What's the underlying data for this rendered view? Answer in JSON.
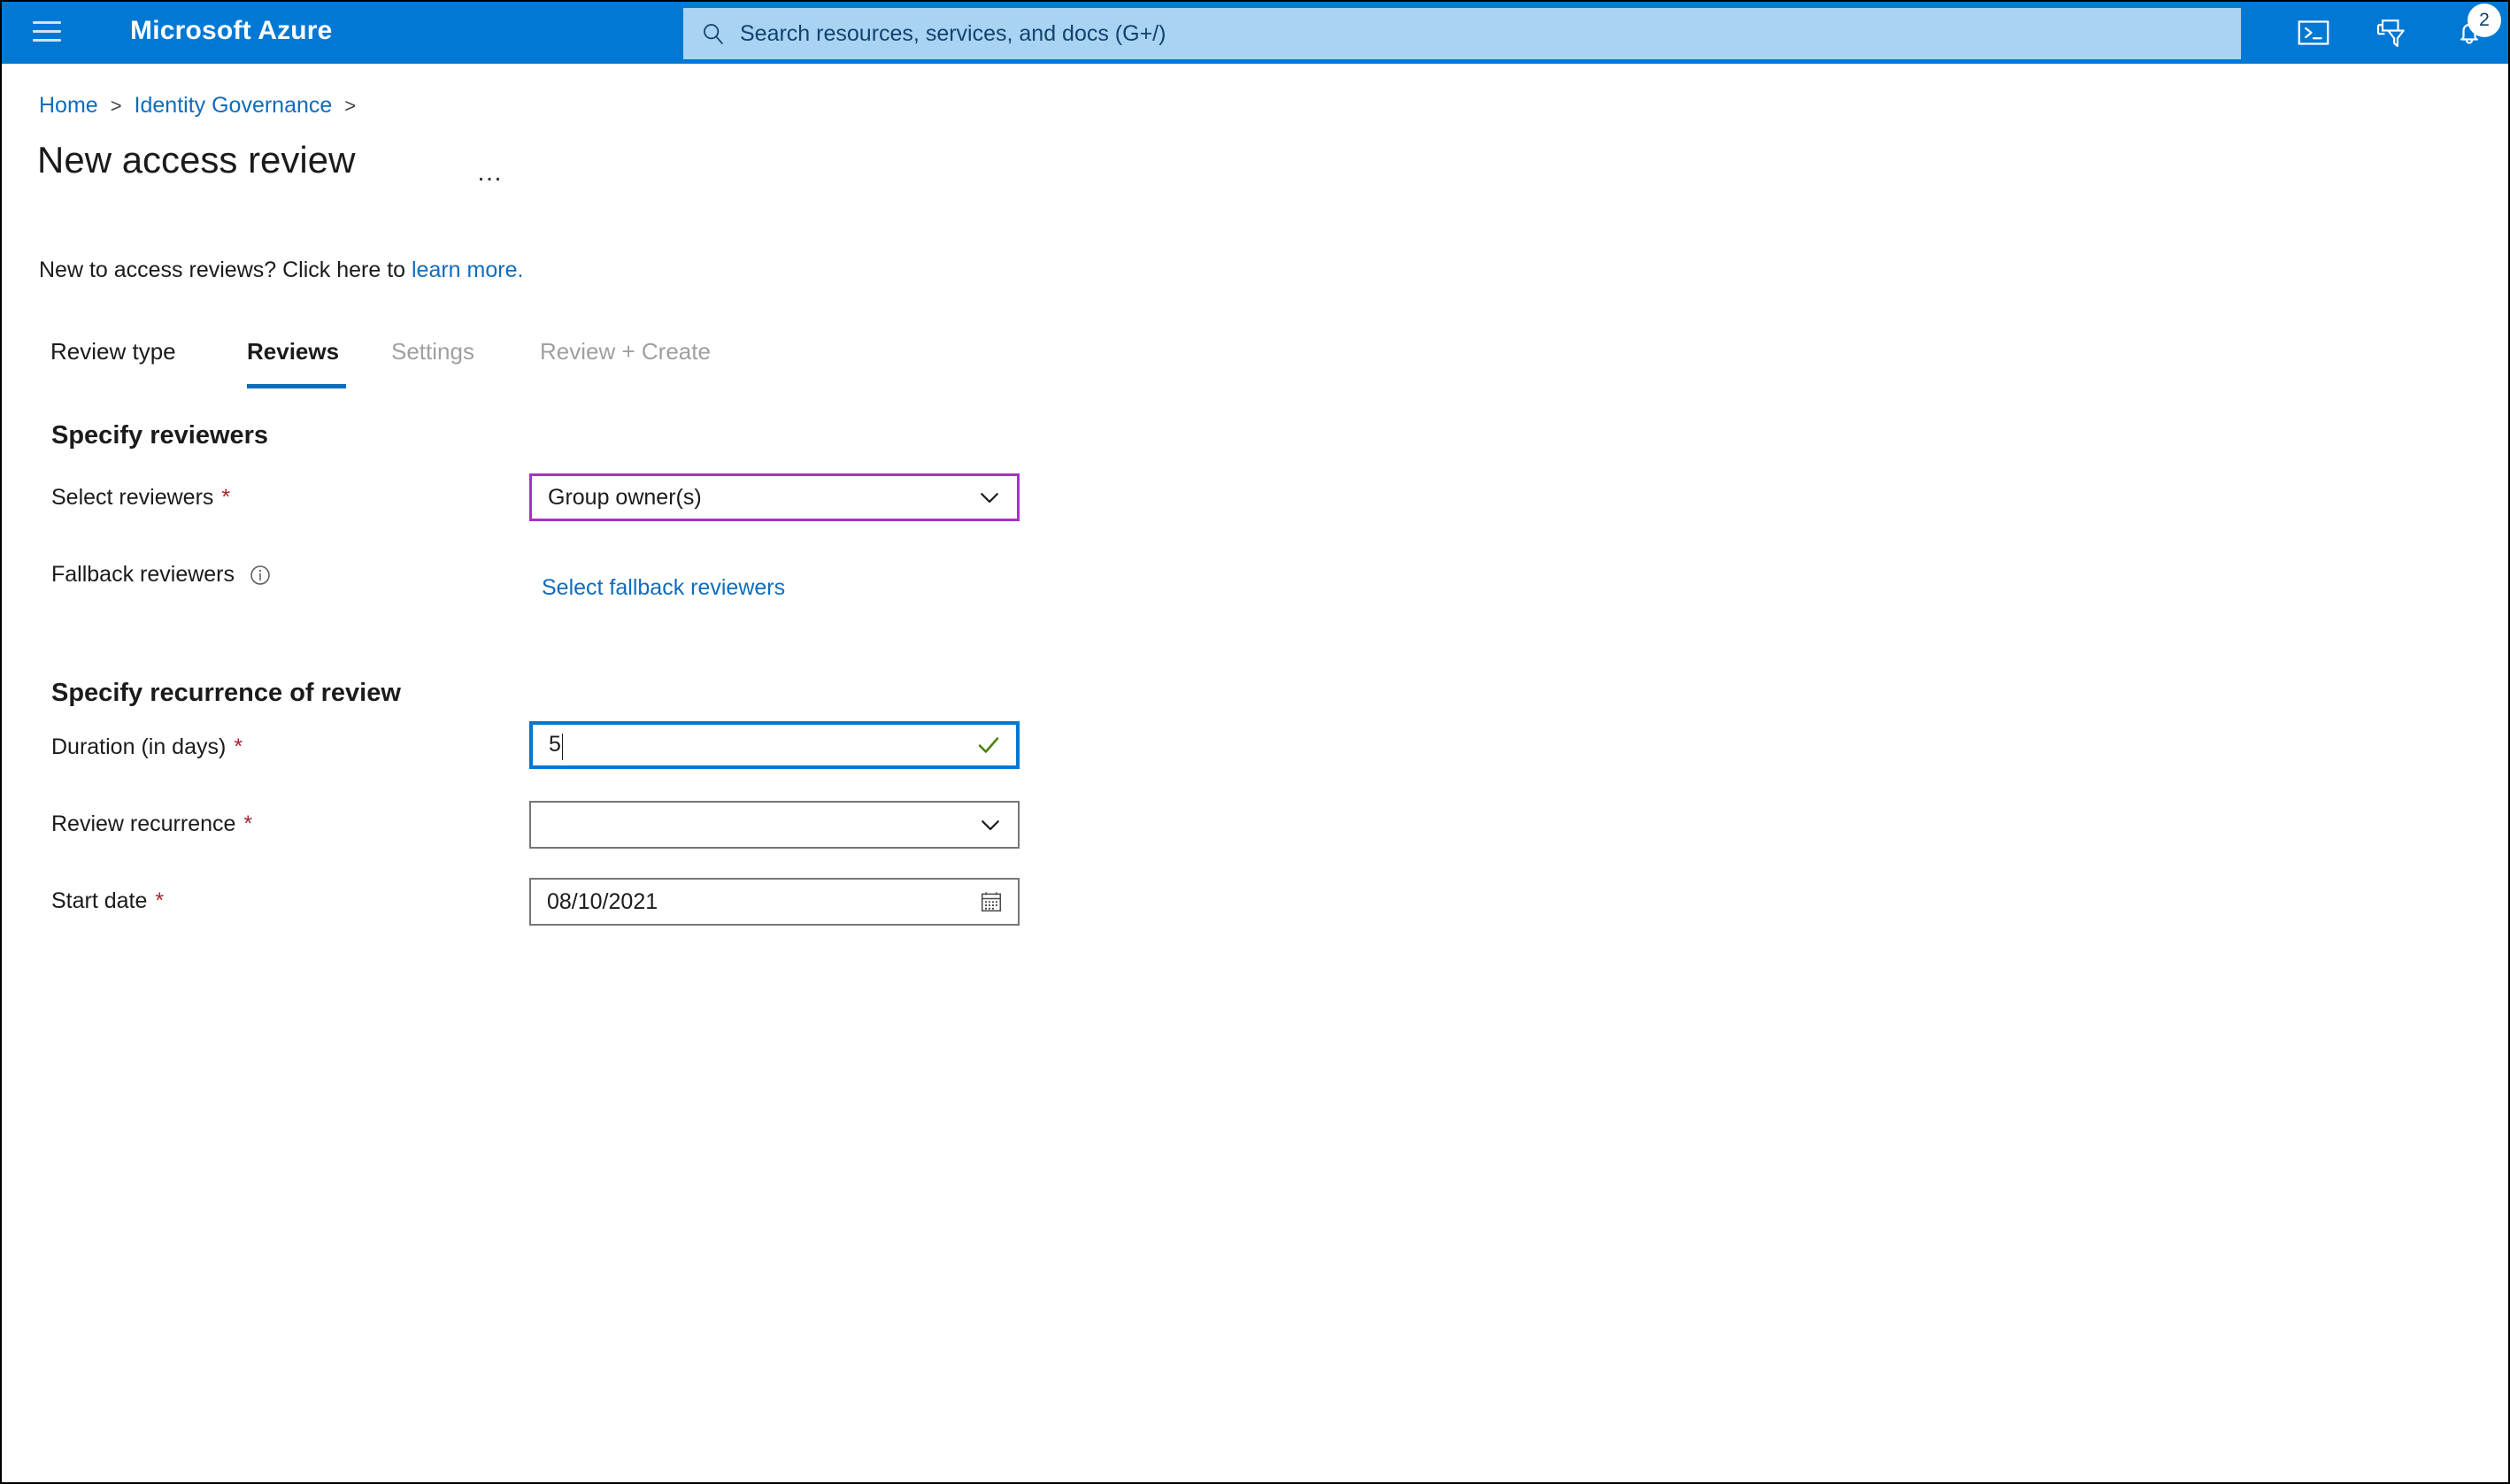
{
  "header": {
    "menu_icon": "hamburger-icon",
    "brand": "Microsoft Azure",
    "search": {
      "placeholder": "Search resources, services, and docs (G+/)",
      "value": "",
      "icon": "search-icon"
    },
    "icons": [
      {
        "name": "cloud-shell-icon",
        "label": "Cloud Shell"
      },
      {
        "name": "directories-subscriptions-icon",
        "label": "Directories + subscriptions"
      },
      {
        "name": "notifications-bell-icon",
        "label": "Notifications",
        "badge": "2"
      }
    ],
    "accent_color": "#0078d4",
    "search_bg_color": "#a9d3f2"
  },
  "breadcrumb": {
    "items": [
      {
        "label": "Home",
        "link": true
      },
      {
        "label": "Identity Governance",
        "link": true
      }
    ],
    "separator": ">"
  },
  "page": {
    "title": "New access review",
    "more_label": "…",
    "intro_prefix": "New to access reviews? Click here to ",
    "intro_link": "learn more."
  },
  "tabs": [
    {
      "label": "Review type",
      "state": "normal"
    },
    {
      "label": "Reviews",
      "state": "active"
    },
    {
      "label": "Settings",
      "state": "disabled"
    },
    {
      "label": "Review + Create",
      "state": "disabled"
    }
  ],
  "sections": [
    {
      "heading": "Specify reviewers",
      "rows": [
        {
          "label": "Select reviewers",
          "required": "*",
          "control": "dropdown",
          "value": "Group owner(s)",
          "border": "purple",
          "border_color": "#a333c8"
        },
        {
          "label": "Fallback reviewers",
          "required": "",
          "info_icon": "info-circle-icon",
          "control": "link",
          "value": "Select fallback reviewers",
          "link_color": "#0f6cbd"
        }
      ]
    },
    {
      "heading": "Specify recurrence of review",
      "rows": [
        {
          "label": "Duration (in days)",
          "required": "*",
          "control": "textbox",
          "value": "5",
          "border": "blue",
          "border_color": "#0078d4",
          "validation_icon": "checkmark-icon",
          "validation_color": "#498205",
          "focused": true
        },
        {
          "label": "Review recurrence",
          "required": "*",
          "control": "dropdown",
          "value": "",
          "border": "grey",
          "border_color": "#767676"
        },
        {
          "label": "Start date",
          "required": "*",
          "control": "datepicker",
          "value": "08/10/2021",
          "border": "grey",
          "border_color": "#767676",
          "trailing_icon": "calendar-icon"
        }
      ]
    }
  ]
}
